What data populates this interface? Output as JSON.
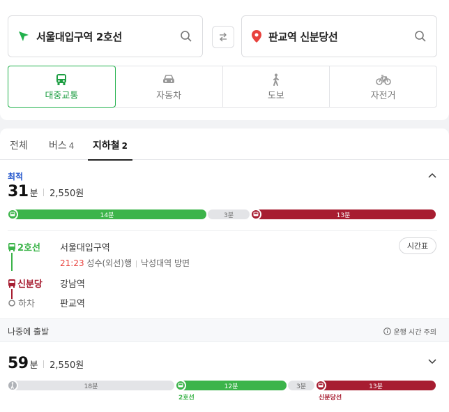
{
  "search": {
    "origin": "서울대입구역 2호선",
    "destination": "판교역 신분당선"
  },
  "modes": [
    {
      "label": "대중교통",
      "icon": "bus-icon"
    },
    {
      "label": "자동차",
      "icon": "car-icon"
    },
    {
      "label": "도보",
      "icon": "walk-icon"
    },
    {
      "label": "자전거",
      "icon": "bicycle-icon"
    }
  ],
  "tabs": [
    {
      "label": "전체",
      "count": ""
    },
    {
      "label": "버스",
      "count": "4"
    },
    {
      "label": "지하철",
      "count": "2"
    }
  ],
  "route1": {
    "badge": "최적",
    "time": "31",
    "time_unit": "분",
    "fare": "2,550원",
    "segments": [
      {
        "type": "line2",
        "label": "14분",
        "minutes": 14
      },
      {
        "type": "walk",
        "label": "3분",
        "minutes": 3
      },
      {
        "type": "shinbundang",
        "label": "13분",
        "minutes": 13
      }
    ],
    "steps": {
      "line2_label": "2호선",
      "line2_station": "서울대입구역",
      "next_time": "21:23",
      "direction": "성수(외선)행",
      "direction_sub": "낙성대역 방면",
      "timetable": "시간표",
      "sb_label": "신분당",
      "sb_station": "강남역",
      "alight_label": "하차",
      "alight_station": "판교역"
    }
  },
  "later": {
    "label": "나중에 출발",
    "notice": "운행 시간 주의"
  },
  "route2": {
    "time": "59",
    "time_unit": "분",
    "fare": "2,550원",
    "segments": [
      {
        "type": "walk",
        "label": "18분",
        "minutes": 18
      },
      {
        "type": "line2",
        "label": "12분",
        "minutes": 12
      },
      {
        "type": "walk",
        "label": "3분",
        "minutes": 3
      },
      {
        "type": "shinbundang",
        "label": "13분",
        "minutes": 13
      }
    ],
    "tag_line2": "2호선",
    "tag_sb": "신분당선"
  },
  "colors": {
    "line2": "#3cb44a",
    "shinbundang": "#a71d31",
    "walk": "#e3e4e7",
    "accent": "#22b14c"
  }
}
